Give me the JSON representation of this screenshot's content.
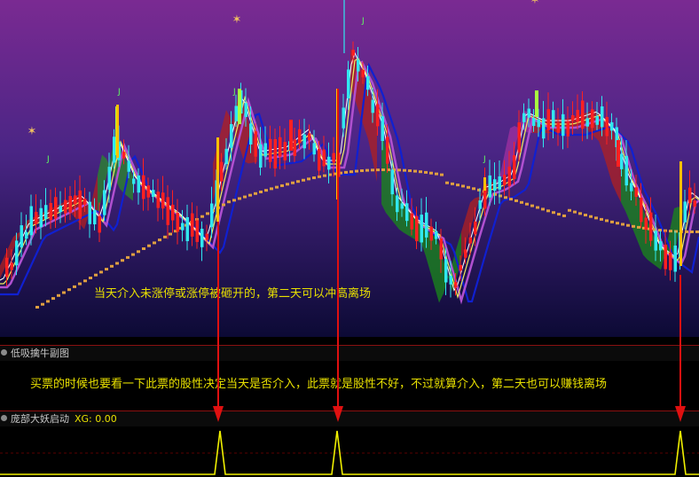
{
  "main_chart": {
    "annotation": "当天介入未涨停或涨停被砸开的，第二天可以冲高离场",
    "colors": {
      "bg_top": "#7a2a92",
      "bg_bottom": "#0c0a35",
      "up": "#ff2020",
      "down": "#30e8f0",
      "ma_gold": "#e0a040"
    }
  },
  "sub_panel_1": {
    "title": "低吸擒牛副图",
    "note": "买票的时候也要看一下此票的股性决定当天是否介入，此票就是股性不好，不过就算介入，第二天也可以赚钱离场"
  },
  "sub_panel_2": {
    "title": "庞部大妖启动",
    "xg_label": "XG: 0.00",
    "signal_color": "#f0f000"
  },
  "markers": [
    "J",
    "J",
    "J",
    "J",
    "J"
  ]
}
